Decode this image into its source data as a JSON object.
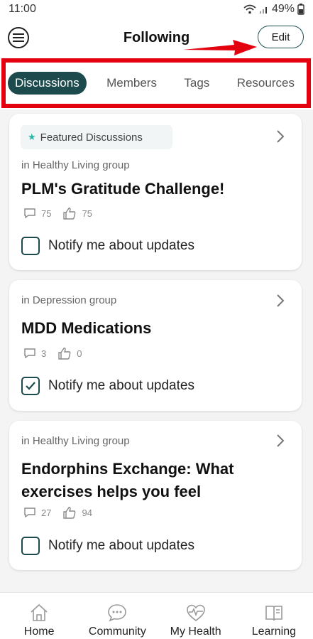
{
  "status_bar": {
    "time": "11:00",
    "battery": "49%"
  },
  "header": {
    "title": "Following",
    "edit_label": "Edit"
  },
  "tabs": [
    {
      "label": "Discussions",
      "active": true
    },
    {
      "label": "Members",
      "active": false
    },
    {
      "label": "Tags",
      "active": false
    },
    {
      "label": "Resources",
      "active": false
    }
  ],
  "cards": [
    {
      "featured_label": "Featured Discussions",
      "group": "in Healthy Living group",
      "title": "PLM's Gratitude Challenge!",
      "comments": "75",
      "likes": "75",
      "notify_label": "Notify me about updates",
      "notify_checked": false
    },
    {
      "group": "in Depression group",
      "title": "MDD Medications",
      "comments": "3",
      "likes": "0",
      "notify_label": "Notify me about updates",
      "notify_checked": true
    },
    {
      "group": "in Healthy Living group",
      "title": "Endorphins Exchange: What exercises helps you feel",
      "comments": "27",
      "likes": "94",
      "notify_label": "Notify me about updates",
      "notify_checked": false
    }
  ],
  "bottom_nav": [
    {
      "label": "Home",
      "icon": "home-icon"
    },
    {
      "label": "Community",
      "icon": "chat-bubble-icon"
    },
    {
      "label": "My Health",
      "icon": "heart-pulse-icon"
    },
    {
      "label": "Learning",
      "icon": "book-icon"
    }
  ],
  "colors": {
    "accent": "#1d4b4d",
    "annotation_red": "#e3000f",
    "featured_star": "#2bb5a6"
  }
}
